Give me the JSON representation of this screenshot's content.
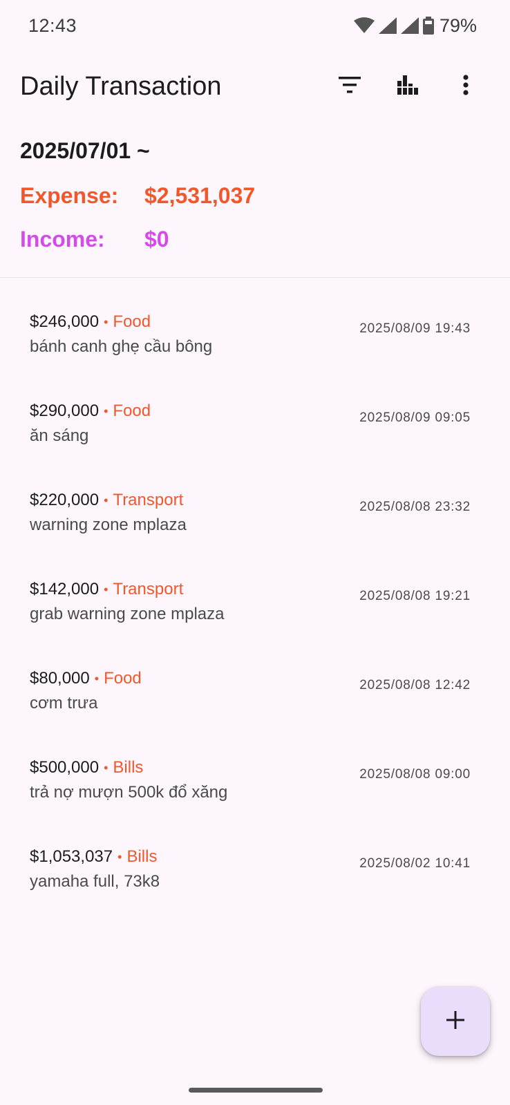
{
  "status_bar": {
    "time": "12:43",
    "battery": "79%",
    "icons": [
      "wifi-icon",
      "signal-icon",
      "signal-icon-2",
      "battery-icon"
    ]
  },
  "app_bar": {
    "title": "Daily Transaction",
    "actions": [
      "filter-icon",
      "bar-chart-icon",
      "more-vert-icon"
    ]
  },
  "summary": {
    "period": "2025/07/01 ~",
    "expense_label": "Expense:",
    "expense_value": "$2,531,037",
    "income_label": "Income:",
    "income_value": "$0"
  },
  "transactions": [
    {
      "amount": "$246,000",
      "category": "Food",
      "note": "bánh canh ghẹ cầu bông",
      "date": "2025/08/09 19:43"
    },
    {
      "amount": "$290,000",
      "category": "Food",
      "note": "ăn sáng",
      "date": "2025/08/09 09:05"
    },
    {
      "amount": "$220,000",
      "category": "Transport",
      "note": "warning zone mplaza",
      "date": "2025/08/08 23:32"
    },
    {
      "amount": "$142,000",
      "category": "Transport",
      "note": "grab warning zone mplaza",
      "date": "2025/08/08 19:21"
    },
    {
      "amount": "$80,000",
      "category": "Food",
      "note": "cơm trưa",
      "date": "2025/08/08 12:42"
    },
    {
      "amount": "$500,000",
      "category": "Bills",
      "note": "trả nợ mượn 500k đổ xăng",
      "date": "2025/08/08 09:00"
    },
    {
      "amount": "$1,053,037",
      "category": "Bills",
      "note": "yamaha full, 73k8",
      "date": "2025/08/02 10:41"
    }
  ],
  "separator": "•",
  "fab_icon": "plus-icon",
  "colors": {
    "expense": "#f0582c",
    "income": "#d44ce8",
    "background": "#fdf7fd",
    "fab": "#eadcfb"
  }
}
